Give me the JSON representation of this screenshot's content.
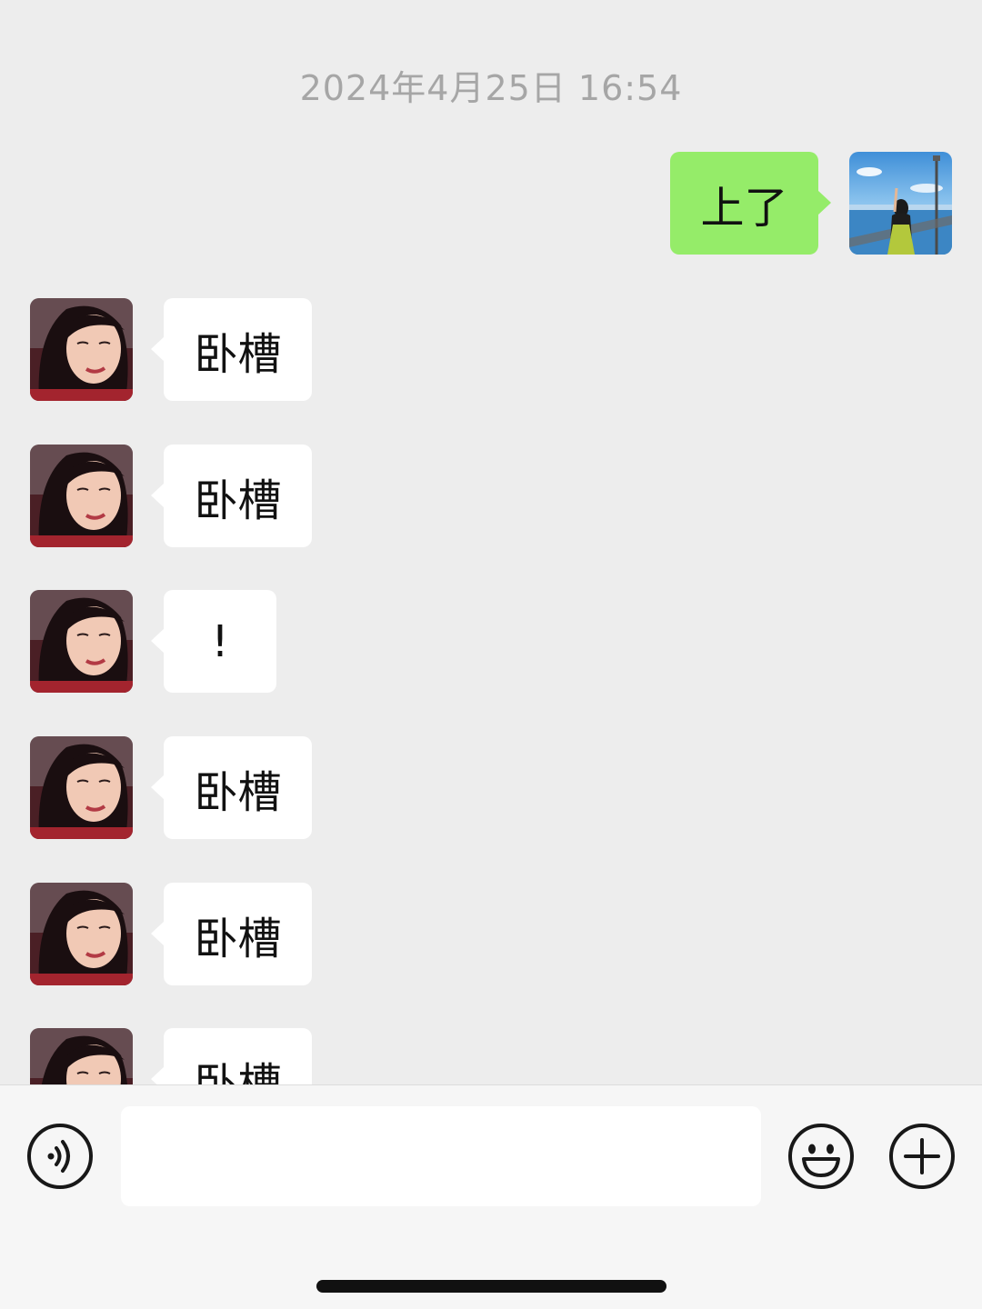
{
  "chat": {
    "timestamp": "2024年4月25日 16:54",
    "messages": [
      {
        "side": "out",
        "text": "上了"
      },
      {
        "side": "in",
        "text": "卧槽"
      },
      {
        "side": "in",
        "text": "卧槽"
      },
      {
        "side": "in",
        "text": "!"
      },
      {
        "side": "in",
        "text": "卧槽"
      },
      {
        "side": "in",
        "text": "卧槽"
      },
      {
        "side": "in",
        "text": "卧槽"
      }
    ]
  },
  "input_bar": {
    "text_value": "",
    "voice_icon": "voice-icon",
    "emoji_icon": "emoji-icon",
    "plus_icon": "plus-icon"
  },
  "colors": {
    "background": "#ededed",
    "outgoing_bubble": "#95ec69",
    "incoming_bubble": "#ffffff",
    "timestamp_text": "#a6a6a6"
  }
}
